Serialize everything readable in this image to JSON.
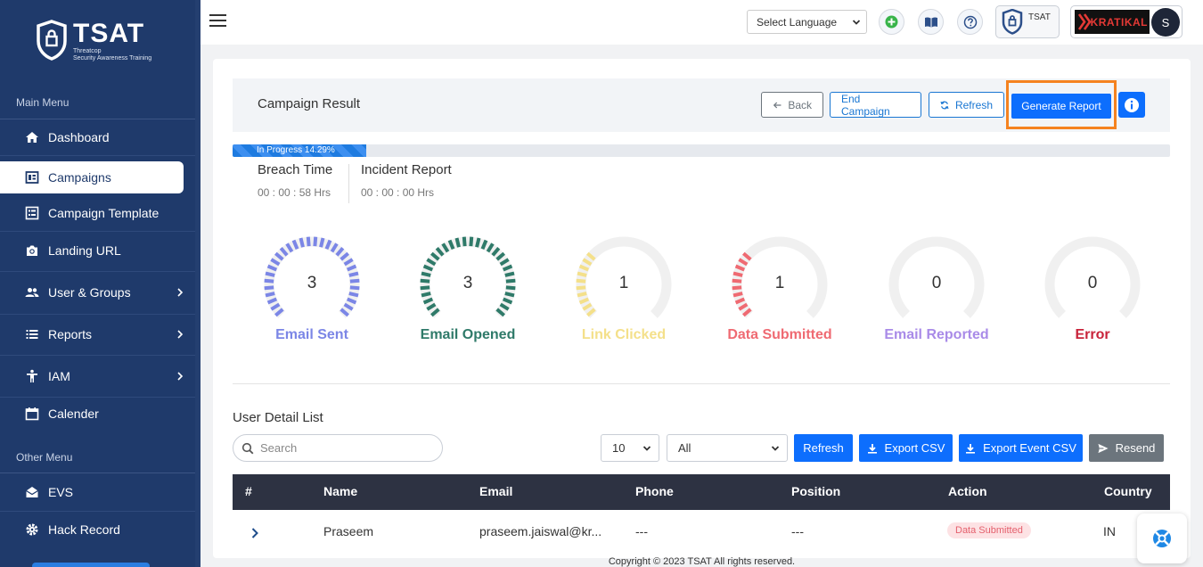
{
  "brand": {
    "name": "TSAT",
    "subtitle_line1": "Threatcop",
    "subtitle_line2": "Security Awareness Training"
  },
  "sidebar": {
    "main_heading": "Main Menu",
    "other_heading": "Other Menu",
    "items": [
      {
        "label": "Dashboard",
        "icon": "home-icon"
      },
      {
        "label": "Campaigns",
        "icon": "campaign-icon",
        "active": true
      },
      {
        "label": "Campaign Template",
        "icon": "template-icon"
      },
      {
        "label": "Landing URL",
        "icon": "camera-icon"
      },
      {
        "label": "User & Groups",
        "icon": "group-icon",
        "expandable": true
      },
      {
        "label": "Reports",
        "icon": "list-icon",
        "expandable": true
      },
      {
        "label": "IAM",
        "icon": "person-icon",
        "expandable": true
      },
      {
        "label": "Calender",
        "icon": "calendar-icon"
      }
    ],
    "other_items": [
      {
        "label": "EVS",
        "icon": "mail-open-icon"
      },
      {
        "label": "Hack Record",
        "icon": "gear-icon"
      }
    ]
  },
  "topbar": {
    "language_label": "Select Language",
    "tsat_badge": "TSAT",
    "org_logo": "KRATIKAL",
    "avatar_initial": "S"
  },
  "header": {
    "title": "Campaign Result",
    "back_label": "Back",
    "end_label": "End Campaign",
    "refresh_label": "Refresh",
    "generate_label": "Generate Report"
  },
  "progress": {
    "label": "In Progress 14.29%",
    "percent": 14.29
  },
  "stats": {
    "breach_label": "Breach Time",
    "breach_value": "00 : 00 : 58 Hrs",
    "incident_label": "Incident Report",
    "incident_value": "00 : 00 : 00 Hrs"
  },
  "gauges": [
    {
      "value": "3",
      "label": "Email Sent",
      "color": "#7b86e6",
      "fraction": 1.0
    },
    {
      "value": "3",
      "label": "Email Opened",
      "color": "#2f7a69",
      "fraction": 1.0
    },
    {
      "value": "1",
      "label": "Link Clicked",
      "color": "#f4e08a",
      "fraction": 0.33
    },
    {
      "value": "1",
      "label": "Data Submitted",
      "color": "#ef6a72",
      "fraction": 0.33
    },
    {
      "value": "0",
      "label": "Email Reported",
      "color": "#a98be8",
      "fraction": 0
    },
    {
      "value": "0",
      "label": "Error",
      "color": "#c8233a",
      "fraction": 0
    }
  ],
  "user_list": {
    "title": "User Detail List",
    "search_placeholder": "Search",
    "page_size": "10",
    "filter": "All",
    "refresh_label": "Refresh",
    "export_csv_label": "Export CSV",
    "export_event_label": "Export Event CSV",
    "resend_label": "Resend",
    "columns": [
      "#",
      "Name",
      "Email",
      "Phone",
      "Position",
      "Action",
      "Country"
    ],
    "rows": [
      {
        "name": "Praseem",
        "email": "praseem.jaiswal@kr...",
        "phone": "---",
        "position": "---",
        "action": "Data Submitted",
        "country": "IN"
      }
    ]
  },
  "footer": {
    "text": "Copyright © 2023 TSAT All rights reserved."
  },
  "colors": {
    "sidebar": "#1f3a6b",
    "primary": "#0d6efd",
    "highlight": "#f5821f",
    "table_header": "#2d3242"
  }
}
